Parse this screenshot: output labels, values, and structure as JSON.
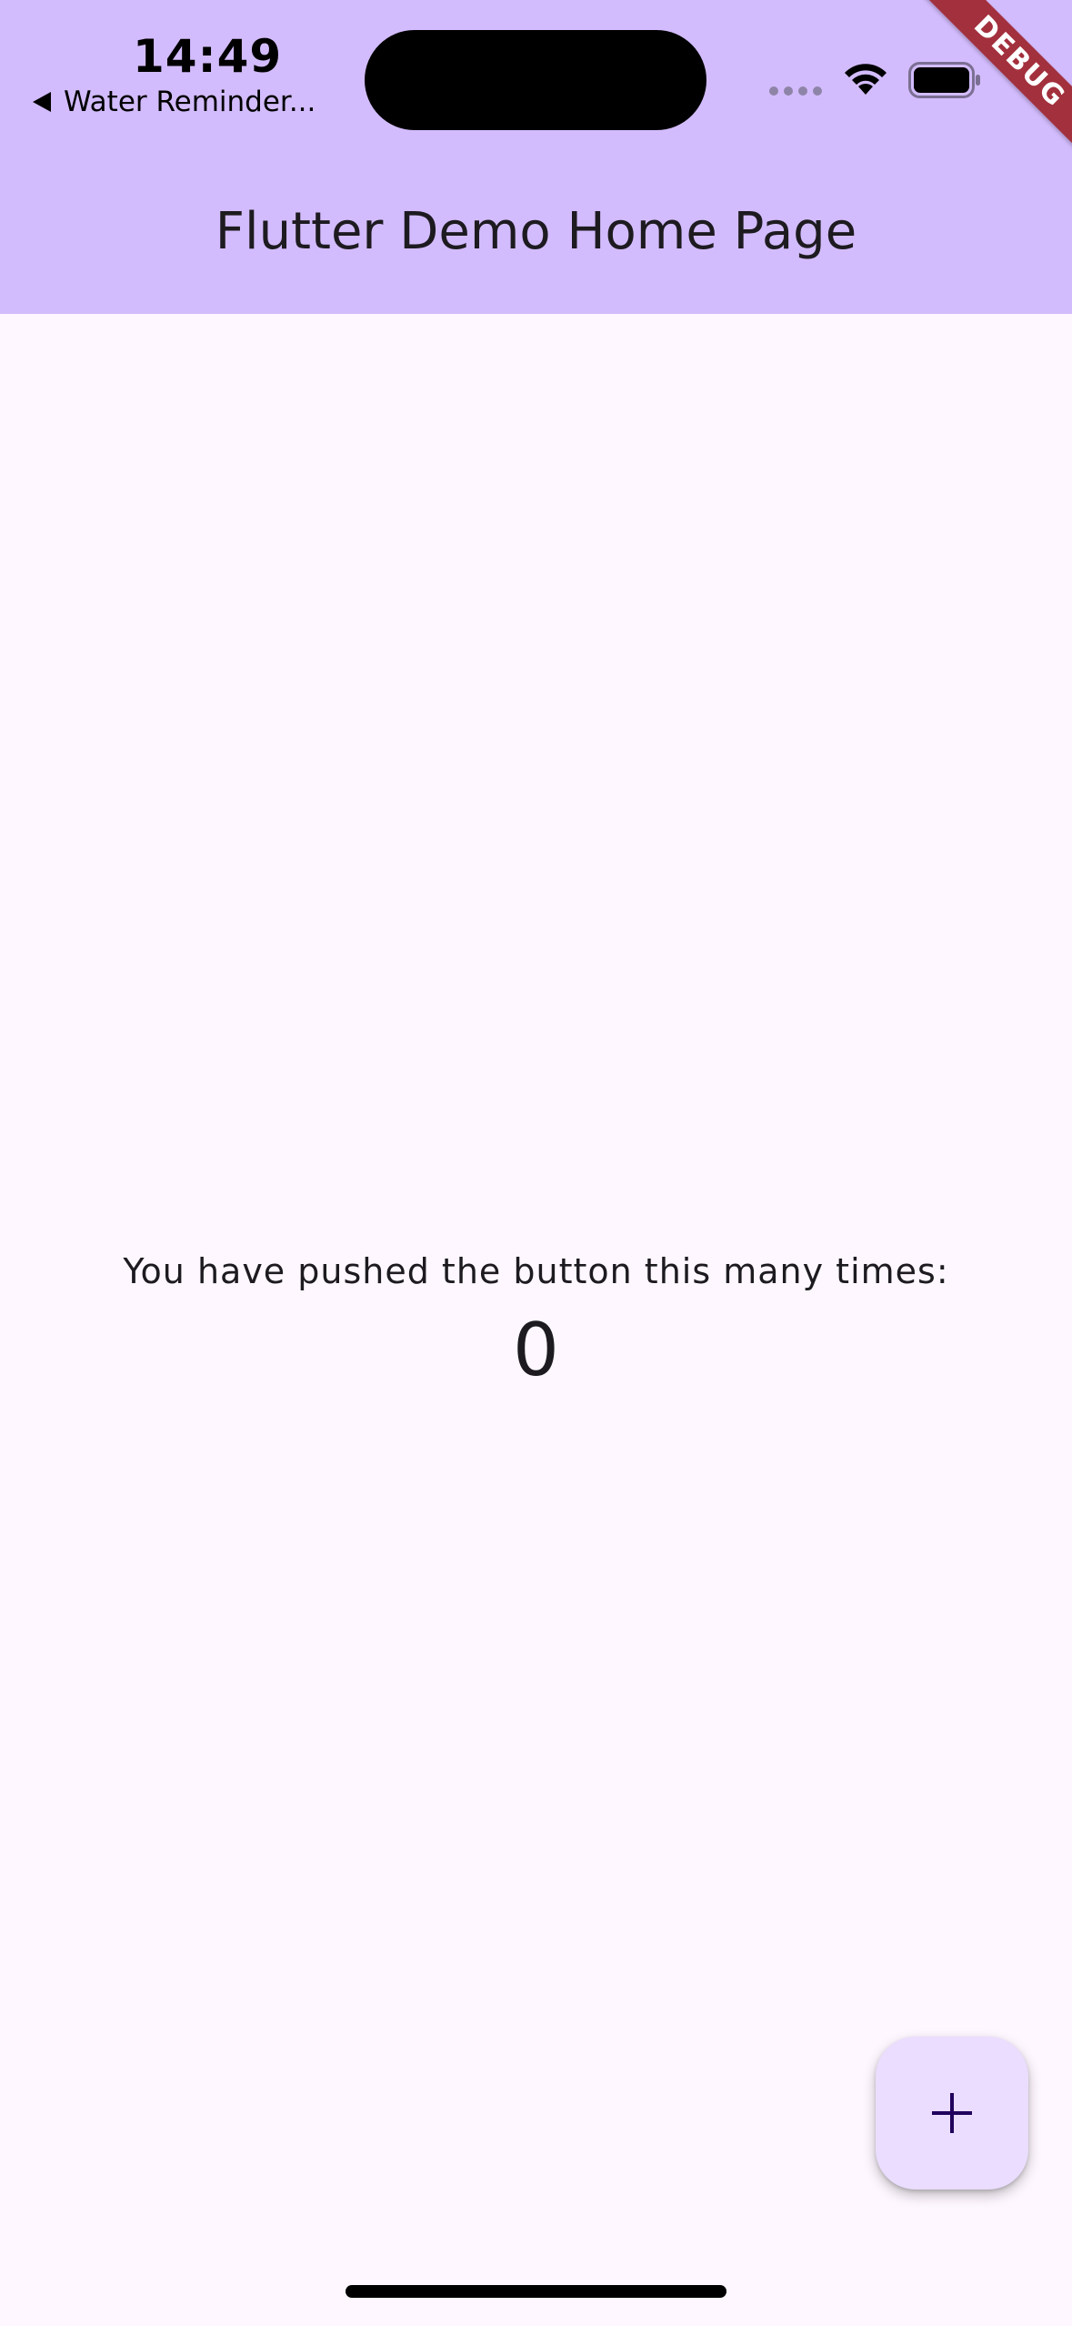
{
  "status_bar": {
    "time": "14:49",
    "back_app_label": "Water Reminder..."
  },
  "debug_banner": {
    "label": "DEBUG"
  },
  "app_bar": {
    "title": "Flutter Demo Home Page"
  },
  "body": {
    "counter_label": "You have pushed the button this many times:",
    "counter_value": "0"
  },
  "fab": {
    "icon": "add-icon"
  },
  "colors": {
    "app_bar_background": "#D3BCFD",
    "page_background": "#FEF7FF",
    "fab_background": "#EADDFF",
    "debug_banner": "#A3303D",
    "text": "#1D1B20"
  }
}
